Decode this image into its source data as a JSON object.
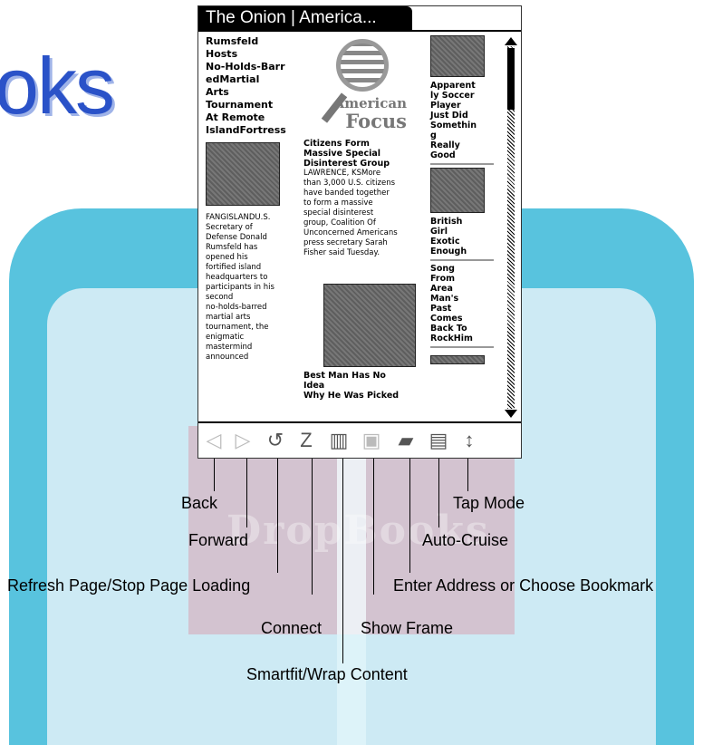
{
  "watermark": {
    "brand_fragment": "oks",
    "overlay_text": "DropBooks"
  },
  "browser": {
    "title": "The Onion | America...",
    "left_column": {
      "headline": [
        "Rumsfeld",
        "Hosts",
        "No-Holds-Barr",
        "edMartial",
        "Arts",
        "Tournament",
        "At Remote",
        "IslandFortress"
      ],
      "body": [
        "FANGISLANDU.S.",
        "Secretary of",
        "Defense Donald",
        "Rumsfeld has",
        "opened his",
        "fortified island",
        "headquarters to",
        "participants in his",
        "second",
        "no-holds-barred",
        "martial arts",
        "tournament, the",
        "enigmatic",
        "mastermind",
        "announced"
      ]
    },
    "middle_column": {
      "logo_line1": "American",
      "logo_line2": "Focus",
      "headline": [
        "Citizens Form",
        "Massive Special",
        "Disinterest Group"
      ],
      "body": [
        "LAWRENCE, KSMore",
        "than 3,000 U.S. citizens",
        "have banded together",
        "to form a massive",
        "special disinterest",
        "group, Coalition Of",
        "Unconcerned Americans",
        "press secretary Sarah",
        "Fisher said Tuesday."
      ],
      "headline2": [
        "Best Man Has No",
        "Idea",
        "Why He Was Picked"
      ]
    },
    "right_column": {
      "headline1": [
        "Apparent",
        "ly Soccer",
        "Player",
        "Just Did",
        "Somethin",
        "g",
        "Really",
        "Good"
      ],
      "headline2": [
        "British",
        "Girl",
        "Exotic",
        "Enough"
      ],
      "headline3": [
        "Song",
        "From",
        "Area",
        "Man's",
        "Past",
        "Comes",
        "Back To",
        "RockHim"
      ]
    },
    "toolbar_icons": [
      "back-icon",
      "forward-icon",
      "refresh-icon",
      "connect-icon",
      "smartfit-icon",
      "show-frame-icon",
      "bookmark-folder-icon",
      "auto-cruise-icon",
      "tap-mode-icon"
    ]
  },
  "callouts": {
    "back": "Back",
    "forward": "Forward",
    "refresh": "Refresh Page/Stop Page Loading",
    "connect": "Connect",
    "smartfit": "Smartfit/Wrap Content",
    "show_frame": "Show Frame",
    "address": "Enter Address or Choose Bookmark",
    "auto_cruise": "Auto-Cruise",
    "tap_mode": "Tap Mode"
  }
}
